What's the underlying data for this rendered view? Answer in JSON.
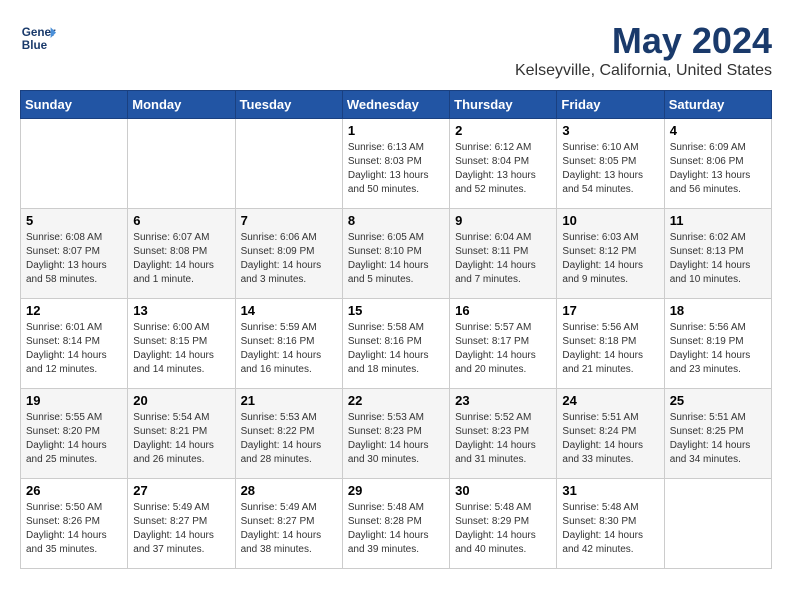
{
  "header": {
    "logo_line1": "General",
    "logo_line2": "Blue",
    "title": "May 2024",
    "subtitle": "Kelseyville, California, United States"
  },
  "weekdays": [
    "Sunday",
    "Monday",
    "Tuesday",
    "Wednesday",
    "Thursday",
    "Friday",
    "Saturday"
  ],
  "weeks": [
    [
      {
        "day": "",
        "info": ""
      },
      {
        "day": "",
        "info": ""
      },
      {
        "day": "",
        "info": ""
      },
      {
        "day": "1",
        "info": "Sunrise: 6:13 AM\nSunset: 8:03 PM\nDaylight: 13 hours\nand 50 minutes."
      },
      {
        "day": "2",
        "info": "Sunrise: 6:12 AM\nSunset: 8:04 PM\nDaylight: 13 hours\nand 52 minutes."
      },
      {
        "day": "3",
        "info": "Sunrise: 6:10 AM\nSunset: 8:05 PM\nDaylight: 13 hours\nand 54 minutes."
      },
      {
        "day": "4",
        "info": "Sunrise: 6:09 AM\nSunset: 8:06 PM\nDaylight: 13 hours\nand 56 minutes."
      }
    ],
    [
      {
        "day": "5",
        "info": "Sunrise: 6:08 AM\nSunset: 8:07 PM\nDaylight: 13 hours\nand 58 minutes."
      },
      {
        "day": "6",
        "info": "Sunrise: 6:07 AM\nSunset: 8:08 PM\nDaylight: 14 hours\nand 1 minute."
      },
      {
        "day": "7",
        "info": "Sunrise: 6:06 AM\nSunset: 8:09 PM\nDaylight: 14 hours\nand 3 minutes."
      },
      {
        "day": "8",
        "info": "Sunrise: 6:05 AM\nSunset: 8:10 PM\nDaylight: 14 hours\nand 5 minutes."
      },
      {
        "day": "9",
        "info": "Sunrise: 6:04 AM\nSunset: 8:11 PM\nDaylight: 14 hours\nand 7 minutes."
      },
      {
        "day": "10",
        "info": "Sunrise: 6:03 AM\nSunset: 8:12 PM\nDaylight: 14 hours\nand 9 minutes."
      },
      {
        "day": "11",
        "info": "Sunrise: 6:02 AM\nSunset: 8:13 PM\nDaylight: 14 hours\nand 10 minutes."
      }
    ],
    [
      {
        "day": "12",
        "info": "Sunrise: 6:01 AM\nSunset: 8:14 PM\nDaylight: 14 hours\nand 12 minutes."
      },
      {
        "day": "13",
        "info": "Sunrise: 6:00 AM\nSunset: 8:15 PM\nDaylight: 14 hours\nand 14 minutes."
      },
      {
        "day": "14",
        "info": "Sunrise: 5:59 AM\nSunset: 8:16 PM\nDaylight: 14 hours\nand 16 minutes."
      },
      {
        "day": "15",
        "info": "Sunrise: 5:58 AM\nSunset: 8:16 PM\nDaylight: 14 hours\nand 18 minutes."
      },
      {
        "day": "16",
        "info": "Sunrise: 5:57 AM\nSunset: 8:17 PM\nDaylight: 14 hours\nand 20 minutes."
      },
      {
        "day": "17",
        "info": "Sunrise: 5:56 AM\nSunset: 8:18 PM\nDaylight: 14 hours\nand 21 minutes."
      },
      {
        "day": "18",
        "info": "Sunrise: 5:56 AM\nSunset: 8:19 PM\nDaylight: 14 hours\nand 23 minutes."
      }
    ],
    [
      {
        "day": "19",
        "info": "Sunrise: 5:55 AM\nSunset: 8:20 PM\nDaylight: 14 hours\nand 25 minutes."
      },
      {
        "day": "20",
        "info": "Sunrise: 5:54 AM\nSunset: 8:21 PM\nDaylight: 14 hours\nand 26 minutes."
      },
      {
        "day": "21",
        "info": "Sunrise: 5:53 AM\nSunset: 8:22 PM\nDaylight: 14 hours\nand 28 minutes."
      },
      {
        "day": "22",
        "info": "Sunrise: 5:53 AM\nSunset: 8:23 PM\nDaylight: 14 hours\nand 30 minutes."
      },
      {
        "day": "23",
        "info": "Sunrise: 5:52 AM\nSunset: 8:23 PM\nDaylight: 14 hours\nand 31 minutes."
      },
      {
        "day": "24",
        "info": "Sunrise: 5:51 AM\nSunset: 8:24 PM\nDaylight: 14 hours\nand 33 minutes."
      },
      {
        "day": "25",
        "info": "Sunrise: 5:51 AM\nSunset: 8:25 PM\nDaylight: 14 hours\nand 34 minutes."
      }
    ],
    [
      {
        "day": "26",
        "info": "Sunrise: 5:50 AM\nSunset: 8:26 PM\nDaylight: 14 hours\nand 35 minutes."
      },
      {
        "day": "27",
        "info": "Sunrise: 5:49 AM\nSunset: 8:27 PM\nDaylight: 14 hours\nand 37 minutes."
      },
      {
        "day": "28",
        "info": "Sunrise: 5:49 AM\nSunset: 8:27 PM\nDaylight: 14 hours\nand 38 minutes."
      },
      {
        "day": "29",
        "info": "Sunrise: 5:48 AM\nSunset: 8:28 PM\nDaylight: 14 hours\nand 39 minutes."
      },
      {
        "day": "30",
        "info": "Sunrise: 5:48 AM\nSunset: 8:29 PM\nDaylight: 14 hours\nand 40 minutes."
      },
      {
        "day": "31",
        "info": "Sunrise: 5:48 AM\nSunset: 8:30 PM\nDaylight: 14 hours\nand 42 minutes."
      },
      {
        "day": "",
        "info": ""
      }
    ]
  ]
}
